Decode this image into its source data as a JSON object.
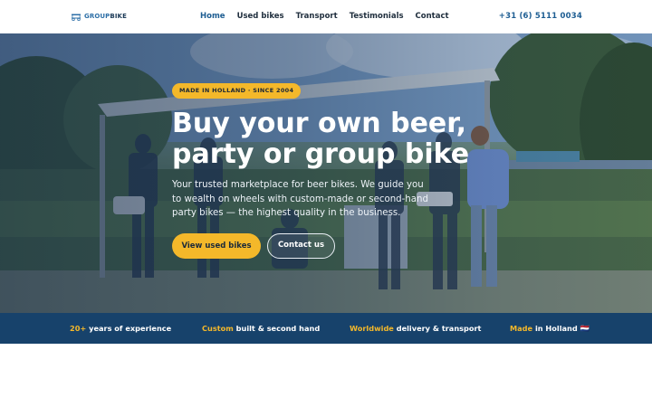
{
  "brand": {
    "name_part1": "GROUP",
    "name_part2": "BIKE"
  },
  "nav": {
    "items": [
      {
        "label": "Home",
        "active": true
      },
      {
        "label": "Used bikes",
        "active": false
      },
      {
        "label": "Transport",
        "active": false
      },
      {
        "label": "Testimonials",
        "active": false
      },
      {
        "label": "Contact",
        "active": false
      }
    ]
  },
  "header": {
    "phone": "+31 (6) 5111 0034"
  },
  "hero": {
    "badge": "MADE IN HOLLAND · SINCE 2004",
    "headline": "Buy your own beer, party or group bike",
    "lead": "Your trusted marketplace for beer bikes. We guide you to wealth on wheels with custom-made or second-hand party bikes — the highest quality in the business.",
    "primary_button": "View used bikes",
    "secondary_button": "Contact us"
  },
  "features": [
    {
      "highlight": "20+",
      "text": " years of experience"
    },
    {
      "highlight": "Custom",
      "text": " built & second hand"
    },
    {
      "highlight": "Worldwide",
      "text": " delivery & transport"
    },
    {
      "highlight": "Made",
      "text": " in Holland 🇳🇱"
    }
  ],
  "colors": {
    "accent": "#f4b82a",
    "brand_blue": "#1d5d92",
    "strip_bg": "#17426b",
    "text_dark": "#1f2e3d"
  }
}
